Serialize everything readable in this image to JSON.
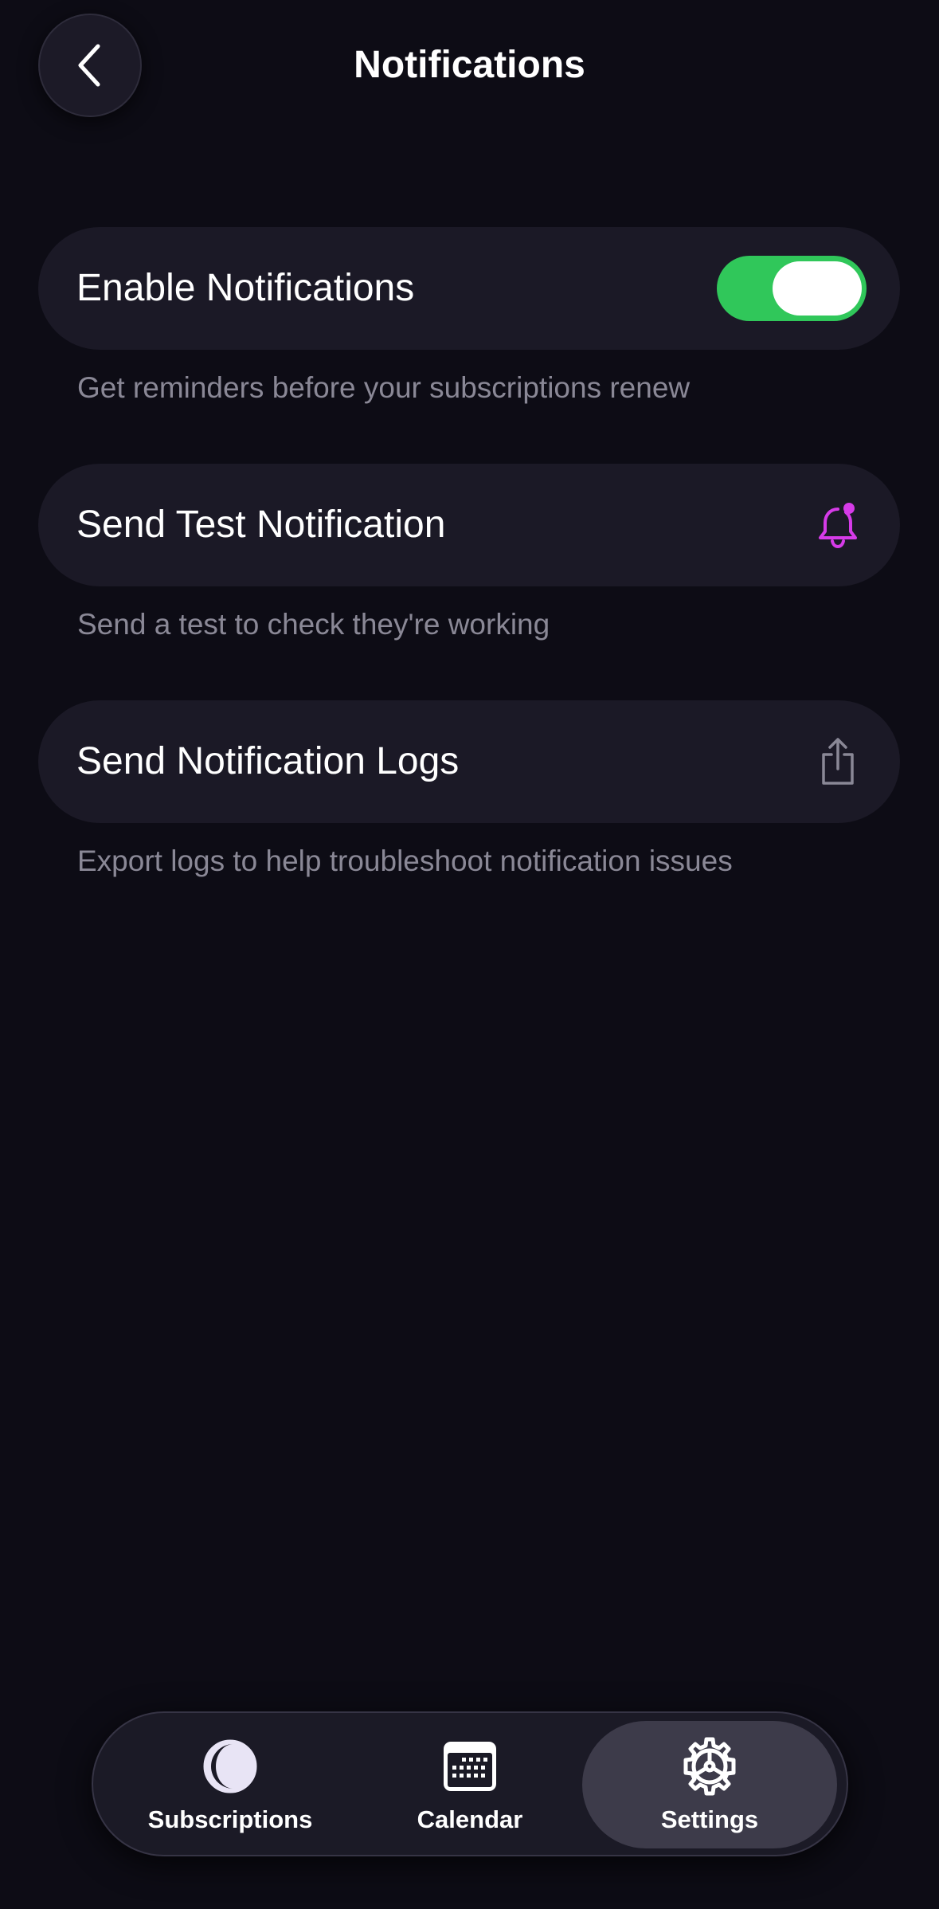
{
  "header": {
    "title": "Notifications"
  },
  "settings": {
    "enable": {
      "label": "Enable Notifications",
      "caption": "Get reminders before your subscriptions renew",
      "enabled": true
    },
    "test": {
      "label": "Send Test Notification",
      "caption": "Send a test to check they're working",
      "icon": "bell-badge-icon"
    },
    "logs": {
      "label": "Send Notification Logs",
      "caption": "Export logs to help troubleshoot notification issues",
      "icon": "share-icon"
    }
  },
  "tabbar": {
    "tabs": [
      {
        "label": "Subscriptions",
        "icon": "subscriptions-icon"
      },
      {
        "label": "Calendar",
        "icon": "calendar-icon"
      },
      {
        "label": "Settings",
        "icon": "gear-icon"
      }
    ],
    "active_index": 2
  },
  "colors": {
    "background": "#0d0c15",
    "card": "#1b1926",
    "toggle_on": "#30c75a",
    "accent_bell": "#d63be8",
    "caption": "#8a8896"
  }
}
